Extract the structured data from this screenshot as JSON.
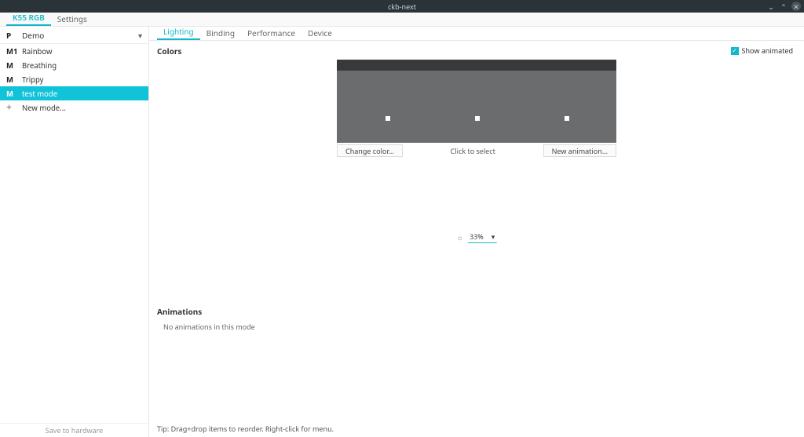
{
  "window": {
    "title": "ckb-next"
  },
  "app_tabs": {
    "items": [
      "K55 RGB",
      "Settings"
    ],
    "active_index": 0
  },
  "sidebar": {
    "profile": {
      "badge": "P",
      "name": "Demo"
    },
    "modes": [
      {
        "badge": "M1",
        "label": "Rainbow"
      },
      {
        "badge": "M",
        "label": "Breathing"
      },
      {
        "badge": "M",
        "label": "Trippy"
      },
      {
        "badge": "M",
        "label": "test mode"
      }
    ],
    "selected_mode_index": 3,
    "new_mode": {
      "icon": "+",
      "label": "New mode..."
    },
    "save_hw": "Save to hardware"
  },
  "subtabs": {
    "items": [
      "Lighting",
      "Binding",
      "Performance",
      "Device"
    ],
    "active_index": 0
  },
  "lighting": {
    "colors_title": "Colors",
    "show_animated": {
      "label": "Show animated",
      "checked": true
    },
    "change_color": "Change color...",
    "click_to_select": "Click to select",
    "new_animation": "New animation...",
    "brightness": {
      "value": "33%"
    },
    "animations_title": "Animations",
    "animations_empty": "No animations in this mode",
    "tip": "Tip: Drag+drop items to reorder. Right-click for menu."
  }
}
